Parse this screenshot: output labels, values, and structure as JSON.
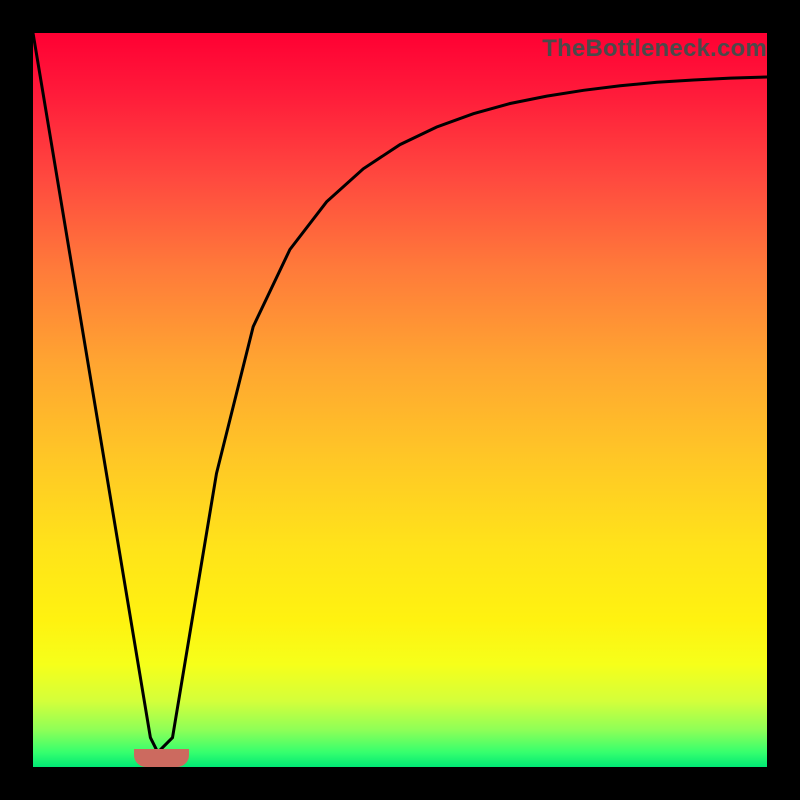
{
  "attribution": "TheBottleneck.com",
  "chart_data": {
    "type": "line",
    "title": "",
    "xlabel": "",
    "ylabel": "",
    "xlim": [
      0,
      100
    ],
    "ylim": [
      0,
      100
    ],
    "grid": false,
    "series": [
      {
        "name": "curve",
        "x": [
          0,
          5,
          10,
          13,
          16,
          17,
          19,
          22,
          25,
          30,
          35,
          40,
          45,
          50,
          55,
          60,
          65,
          70,
          75,
          80,
          85,
          90,
          95,
          100
        ],
        "values": [
          100,
          70,
          40,
          22,
          4,
          2,
          4,
          22,
          40,
          60,
          70.5,
          77,
          81.5,
          84.8,
          87.2,
          89,
          90.4,
          91.4,
          92.2,
          92.8,
          93.3,
          93.6,
          93.85,
          94
        ]
      }
    ],
    "marker": {
      "x_start": 13.8,
      "x_end": 21.2,
      "y": 1.2
    },
    "colors": {
      "curve_stroke": "#000000",
      "marker_fill": "#cc6a5f",
      "gradient_top": "#ff0033",
      "gradient_bottom": "#00e874"
    }
  }
}
